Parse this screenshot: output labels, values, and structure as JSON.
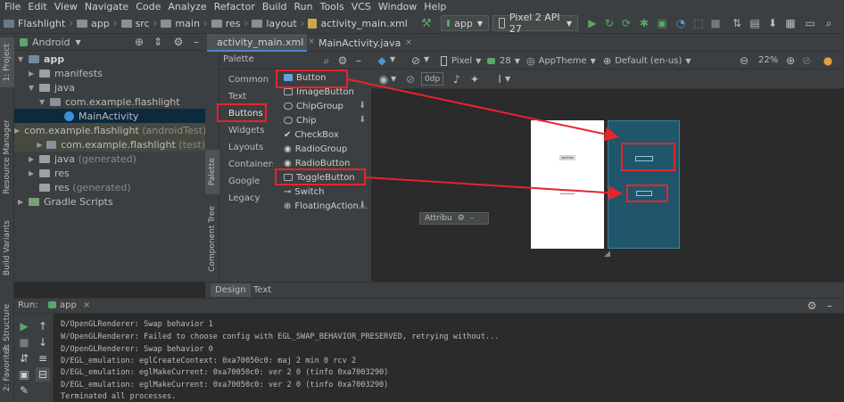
{
  "menu": [
    "File",
    "Edit",
    "View",
    "Navigate",
    "Code",
    "Analyze",
    "Refactor",
    "Build",
    "Run",
    "Tools",
    "VCS",
    "Window",
    "Help"
  ],
  "breadcrumb": [
    "Flashlight",
    "app",
    "src",
    "main",
    "res",
    "layout",
    "activity_main.xml"
  ],
  "toolbar": {
    "run_config": "app",
    "device": "Pixel 2 API 27"
  },
  "side_tabs": {
    "project": "1: Project",
    "resource_manager": "Resource Manager",
    "build_variants": "Build Variants",
    "structure": "7: Structure",
    "favorites": "2: Favorites"
  },
  "project_panel": {
    "view": "Android",
    "tree": [
      {
        "label": "app",
        "note": ""
      },
      {
        "label": "manifests",
        "note": ""
      },
      {
        "label": "java",
        "note": ""
      },
      {
        "label": "com.example.flashlight",
        "note": ""
      },
      {
        "label": "MainActivity",
        "note": ""
      },
      {
        "label": "com.example.flashlight",
        "note": "(androidTest)"
      },
      {
        "label": "com.example.flashlight",
        "note": "(test)"
      },
      {
        "label": "java",
        "note": "(generated)"
      },
      {
        "label": "res",
        "note": ""
      },
      {
        "label": "res",
        "note": "(generated)"
      },
      {
        "label": "Gradle Scripts",
        "note": ""
      }
    ]
  },
  "editor_tabs": [
    "activity_main.xml",
    "MainActivity.java"
  ],
  "design_toolbar": {
    "palette_title": "Palette",
    "device": "Pixel",
    "api": "28",
    "theme": "AppTheme",
    "locale": "Default (en-us)",
    "zoom": "22%",
    "margin": "0dp"
  },
  "palette_panel_tabs": {
    "palette": "Palette",
    "component_tree": "Component Tree"
  },
  "palette_categories": [
    "Common",
    "Text",
    "Buttons",
    "Widgets",
    "Layouts",
    "Containers",
    "Google",
    "Legacy"
  ],
  "palette_items": [
    "Button",
    "ImageButton",
    "ChipGroup",
    "Chip",
    "CheckBox",
    "RadioGroup",
    "RadioButton",
    "ToggleButton",
    "Switch",
    "FloatingAction..."
  ],
  "attributes_label": "Attribu",
  "preview": {
    "button_text": "BUTTON"
  },
  "bottom_tabs": [
    "Design",
    "Text"
  ],
  "run": {
    "label": "Run:",
    "config": "app",
    "console": [
      "D/OpenGLRenderer: Swap behavior 1",
      "W/OpenGLRenderer: Failed to choose config with EGL_SWAP_BEHAVIOR_PRESERVED, retrying without...",
      "D/OpenGLRenderer: Swap behavior 0",
      "D/EGL_emulation: eglCreateContext: 0xa70050c0: maj 2 min 0 rcv 2",
      "D/EGL_emulation: eglMakeCurrent: 0xa70050c0: ver 2 0 (tinfo 0xa7003290)",
      "D/EGL_emulation: eglMakeCurrent: 0xa70050c0: ver 2 0 (tinfo 0xa7003290)",
      "Terminated all processes."
    ]
  },
  "colors": {
    "annotation_red": "#e8242b",
    "blueprint": "#20566b",
    "run_green": "#59a869",
    "selected_row": "#0d293e"
  }
}
